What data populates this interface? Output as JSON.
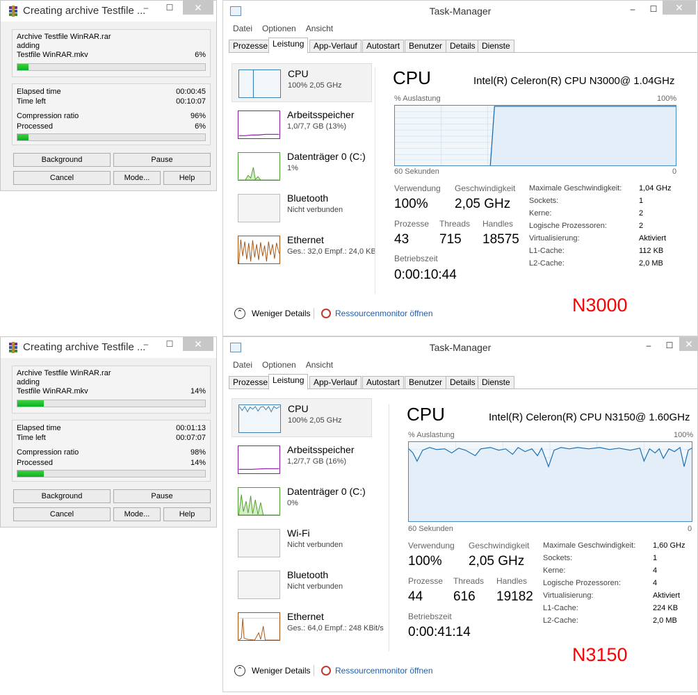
{
  "colors": {
    "accent": "#4a8ac3",
    "progress": "#06b025",
    "annotation": "#ff0000"
  },
  "rar_top": {
    "title": "Creating archive Testfile ...",
    "controls": {
      "min": "–",
      "max": "☐",
      "close": "✕"
    },
    "archive_line": "Archive Testfile WinRAR.rar",
    "action": "adding",
    "file": "Testfile WinRAR.mkv",
    "file_percent": "6%",
    "file_progress": 0.06,
    "elapsed_label": "Elapsed time",
    "elapsed": "00:00:45",
    "timeleft_label": "Time left",
    "timeleft": "00:10:07",
    "ratio_label": "Compression ratio",
    "ratio": "96%",
    "processed_label": "Processed",
    "processed": "6%",
    "processed_progress": 0.06,
    "buttons": {
      "background": "Background",
      "pause": "Pause",
      "cancel": "Cancel",
      "mode": "Mode...",
      "help": "Help"
    }
  },
  "rar_bottom": {
    "title": "Creating archive Testfile ...",
    "controls": {
      "min": "–",
      "max": "☐",
      "close": "✕"
    },
    "archive_line": "Archive Testfile WinRAR.rar",
    "action": "adding",
    "file": "Testfile WinRAR.mkv",
    "file_percent": "14%",
    "file_progress": 0.14,
    "elapsed_label": "Elapsed time",
    "elapsed": "00:01:13",
    "timeleft_label": "Time left",
    "timeleft": "00:07:07",
    "ratio_label": "Compression ratio",
    "ratio": "98%",
    "processed_label": "Processed",
    "processed": "14%",
    "processed_progress": 0.14,
    "buttons": {
      "background": "Background",
      "pause": "Pause",
      "cancel": "Cancel",
      "mode": "Mode...",
      "help": "Help"
    }
  },
  "tm_top": {
    "title": "Task-Manager",
    "controls": {
      "min": "–",
      "max": "☐",
      "close": "✕"
    },
    "menu": [
      "Datei",
      "Optionen",
      "Ansicht"
    ],
    "tabs": [
      "Prozesse",
      "Leistung",
      "App-Verlauf",
      "Autostart",
      "Benutzer",
      "Details",
      "Dienste"
    ],
    "active_tab": "Leistung",
    "sidebar": [
      {
        "name": "CPU",
        "sub": "100% 2,05 GHz",
        "icon": "cpu-graph"
      },
      {
        "name": "Arbeitsspeicher",
        "sub": "1,0/7,7 GB (13%)",
        "icon": "memory-graph"
      },
      {
        "name": "Datenträger 0 (C:)",
        "sub": "1%",
        "icon": "disk-graph"
      },
      {
        "name": "Bluetooth",
        "sub": "Nicht verbunden",
        "icon": "bluetooth-graph"
      },
      {
        "name": "Ethernet",
        "sub": "Ges.: 32,0 Empf.: 24,0 KB",
        "icon": "ethernet-graph"
      }
    ],
    "heading": "CPU",
    "processor": "Intel(R) Celeron(R) CPU N3000@ 1.04GHz",
    "graph_label": "% Auslastung",
    "graph_max": "100%",
    "graph_time": "60 Sekunden",
    "graph_zero": "0",
    "stats": {
      "usage_label": "Verwendung",
      "usage": "100%",
      "speed_label": "Geschwindigkeit",
      "speed": "2,05 GHz",
      "processes_label": "Prozesse",
      "processes": "43",
      "threads_label": "Threads",
      "threads": "715",
      "handles_label": "Handles",
      "handles": "18575",
      "uptime_label": "Betriebszeit",
      "uptime": "0:00:10:44"
    },
    "specs": [
      {
        "k": "Maximale Geschwindigkeit:",
        "v": "1,04 GHz"
      },
      {
        "k": "Sockets:",
        "v": "1"
      },
      {
        "k": "Kerne:",
        "v": "2"
      },
      {
        "k": "Logische Prozessoren:",
        "v": "2"
      },
      {
        "k": "Virtualisierung:",
        "v": "Aktiviert"
      },
      {
        "k": "L1-Cache:",
        "v": "112 KB"
      },
      {
        "k": "L2-Cache:",
        "v": "2,0 MB"
      }
    ],
    "fewer_details": "Weniger Details",
    "resource_monitor": "Ressourcenmonitor öffnen",
    "annotation": "N3000"
  },
  "tm_bottom": {
    "title": "Task-Manager",
    "controls": {
      "min": "–",
      "max": "☐",
      "close": "✕"
    },
    "menu": [
      "Datei",
      "Optionen",
      "Ansicht"
    ],
    "tabs": [
      "Prozesse",
      "Leistung",
      "App-Verlauf",
      "Autostart",
      "Benutzer",
      "Details",
      "Dienste"
    ],
    "active_tab": "Leistung",
    "sidebar": [
      {
        "name": "CPU",
        "sub": "100% 2,05 GHz",
        "icon": "cpu-graph"
      },
      {
        "name": "Arbeitsspeicher",
        "sub": "1,2/7,7 GB (16%)",
        "icon": "memory-graph"
      },
      {
        "name": "Datenträger 0 (C:)",
        "sub": "0%",
        "icon": "disk-graph"
      },
      {
        "name": "Wi-Fi",
        "sub": "Nicht verbunden",
        "icon": "wifi-graph"
      },
      {
        "name": "Bluetooth",
        "sub": "Nicht verbunden",
        "icon": "bluetooth-graph"
      },
      {
        "name": "Ethernet",
        "sub": "Ges.: 64,0 Empf.: 248 KBit/s",
        "icon": "ethernet-graph"
      }
    ],
    "heading": "CPU",
    "processor": "Intel(R) Celeron(R) CPU N3150@ 1.60GHz",
    "graph_label": "% Auslastung",
    "graph_max": "100%",
    "graph_time": "60 Sekunden",
    "graph_zero": "0",
    "stats": {
      "usage_label": "Verwendung",
      "usage": "100%",
      "speed_label": "Geschwindigkeit",
      "speed": "2,05 GHz",
      "processes_label": "Prozesse",
      "processes": "44",
      "threads_label": "Threads",
      "threads": "616",
      "handles_label": "Handles",
      "handles": "19182",
      "uptime_label": "Betriebszeit",
      "uptime": "0:00:41:14"
    },
    "specs": [
      {
        "k": "Maximale Geschwindigkeit:",
        "v": "1,60 GHz"
      },
      {
        "k": "Sockets:",
        "v": "1"
      },
      {
        "k": "Kerne:",
        "v": "4"
      },
      {
        "k": "Logische Prozessoren:",
        "v": "4"
      },
      {
        "k": "Virtualisierung:",
        "v": "Aktiviert"
      },
      {
        "k": "L1-Cache:",
        "v": "224 KB"
      },
      {
        "k": "L2-Cache:",
        "v": "2,0 MB"
      }
    ],
    "fewer_details": "Weniger Details",
    "resource_monitor": "Ressourcenmonitor öffnen",
    "annotation": "N3150"
  }
}
